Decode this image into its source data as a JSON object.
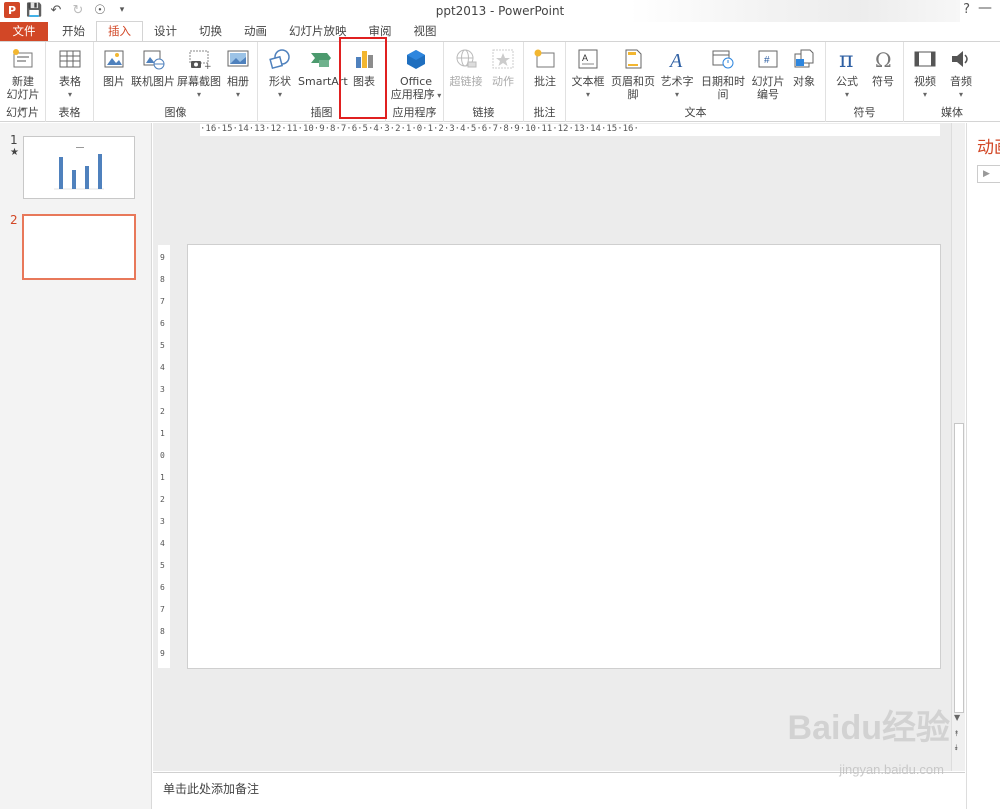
{
  "window": {
    "title": "ppt2013 - PowerPoint",
    "help": "?",
    "minimize": "—"
  },
  "tabs": [
    "文件",
    "开始",
    "插入",
    "设计",
    "切换",
    "动画",
    "幻灯片放映",
    "审阅",
    "视图"
  ],
  "active_tab": "插入",
  "ribbon": {
    "groups": {
      "slides": "幻灯片",
      "tables": "表格",
      "images": "图像",
      "illustrations": "插图",
      "apps": "应用程序",
      "links": "链接",
      "comments": "批注",
      "text": "文本",
      "symbols": "符号",
      "media": "媒体"
    },
    "buttons": {
      "new_slide_1": "新建",
      "new_slide_2": "幻灯片",
      "table": "表格",
      "picture": "图片",
      "online_picture": "联机图片",
      "screenshot": "屏幕截图",
      "album": "相册",
      "shapes": "形状",
      "smartart": "SmartArt",
      "chart": "图表",
      "office_1": "Office",
      "office_2": "应用程序",
      "hyperlink": "超链接",
      "action": "动作",
      "comment": "批注",
      "textbox": "文本框",
      "header_footer": "页眉和页脚",
      "wordart": "艺术字",
      "datetime": "日期和时间",
      "slide_number_1": "幻灯片",
      "slide_number_2": "编号",
      "object": "对象",
      "equation": "公式",
      "symbol": "符号",
      "video": "视频",
      "audio": "音频"
    }
  },
  "slides_panel": {
    "slide1_num": "1",
    "slide1_star": "★",
    "slide2_num": "2"
  },
  "ruler": {
    "horizontal": "·16·15·14·13·12·11·10·9·8·7·6·5·4·3·2·1·0·1·2·3·4·5·6·7·8·9·10·11·12·13·14·15·16·",
    "vertical": [
      "9",
      "8",
      "7",
      "6",
      "5",
      "4",
      "3",
      "2",
      "1",
      "0",
      "1",
      "2",
      "3",
      "4",
      "5",
      "6",
      "7",
      "8",
      "9"
    ]
  },
  "notes": {
    "placeholder": "单击此处添加备注"
  },
  "task_pane": {
    "title": "动画"
  },
  "watermark": {
    "logo": "Baidu经验",
    "url": "jingyan.baidu.com"
  },
  "colors": {
    "accent": "#d24726",
    "highlight": "#e02020",
    "chart_blue": "#4f81bd"
  }
}
